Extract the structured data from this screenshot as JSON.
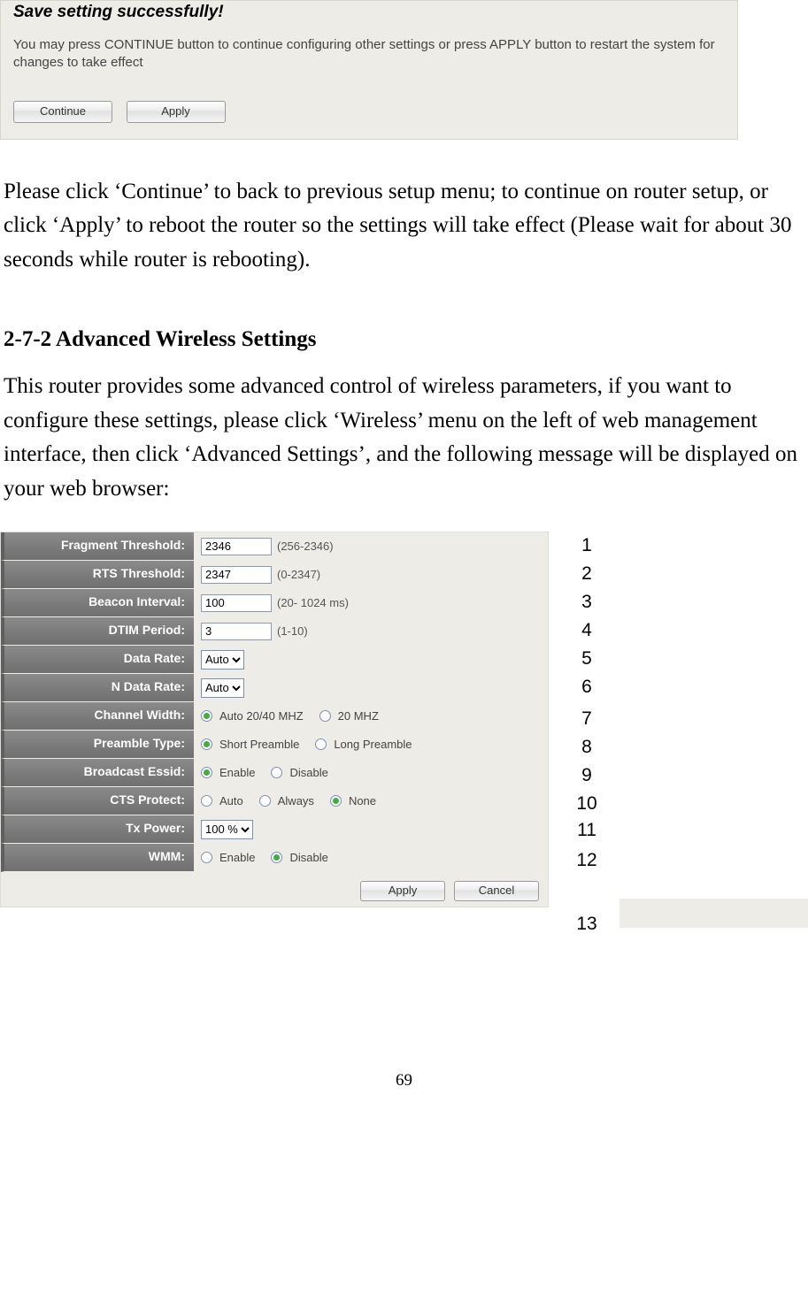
{
  "dialog": {
    "title": "Save setting successfully!",
    "body": "You may press CONTINUE button to continue configuring other settings or press APPLY button to restart the system for changes to take effect",
    "continue_label": "Continue",
    "apply_label": "Apply"
  },
  "paragraph_after_dialog": "Please click ‘Continue’ to back to previous setup menu; to continue on router setup, or click ‘Apply’ to reboot the router so the settings will take effect (Please wait for about 30 seconds while router is rebooting).",
  "section_heading": "2-7-2 Advanced Wireless Settings",
  "section_intro": "This router provides some advanced control of wireless parameters, if you want to configure these settings, please click ‘Wireless’ menu on the left of web management interface, then click ‘Advanced Settings’, and the following message will be displayed on your web browser:",
  "form": {
    "rows": [
      {
        "label": "Fragment Threshold:",
        "input_value": "2346",
        "hint": "(256-2346)"
      },
      {
        "label": "RTS Threshold:",
        "input_value": "2347",
        "hint": "(0-2347)"
      },
      {
        "label": "Beacon Interval:",
        "input_value": "100",
        "hint": "(20- 1024 ms)"
      },
      {
        "label": "DTIM Period:",
        "input_value": "3",
        "hint": "(1-10)"
      },
      {
        "label": "Data Rate:",
        "select_value": "Auto"
      },
      {
        "label": "N Data Rate:",
        "select_value": "Auto"
      },
      {
        "label": "Channel Width:",
        "radio_options": [
          {
            "text": "Auto 20/40 MHZ",
            "checked": true
          },
          {
            "text": "20 MHZ",
            "checked": false
          }
        ]
      },
      {
        "label": "Preamble Type:",
        "radio_options": [
          {
            "text": "Short Preamble",
            "checked": true
          },
          {
            "text": "Long Preamble",
            "checked": false
          }
        ]
      },
      {
        "label": "Broadcast Essid:",
        "radio_options": [
          {
            "text": "Enable",
            "checked": true
          },
          {
            "text": "Disable",
            "checked": false
          }
        ]
      },
      {
        "label": "CTS Protect:",
        "radio_options": [
          {
            "text": "Auto",
            "checked": false
          },
          {
            "text": "Always",
            "checked": false
          },
          {
            "text": "None",
            "checked": true
          }
        ]
      },
      {
        "label": "Tx Power:",
        "select_value": "100 %"
      },
      {
        "label": "WMM:",
        "radio_options": [
          {
            "text": "Enable",
            "checked": false
          },
          {
            "text": "Disable",
            "checked": true
          }
        ]
      }
    ],
    "apply_label": "Apply",
    "cancel_label": "Cancel"
  },
  "callouts": [
    "1",
    "2",
    "3",
    "4",
    "5",
    "6",
    "7",
    "8",
    "9",
    "10",
    "11",
    "12",
    "13"
  ],
  "page_number": "69"
}
